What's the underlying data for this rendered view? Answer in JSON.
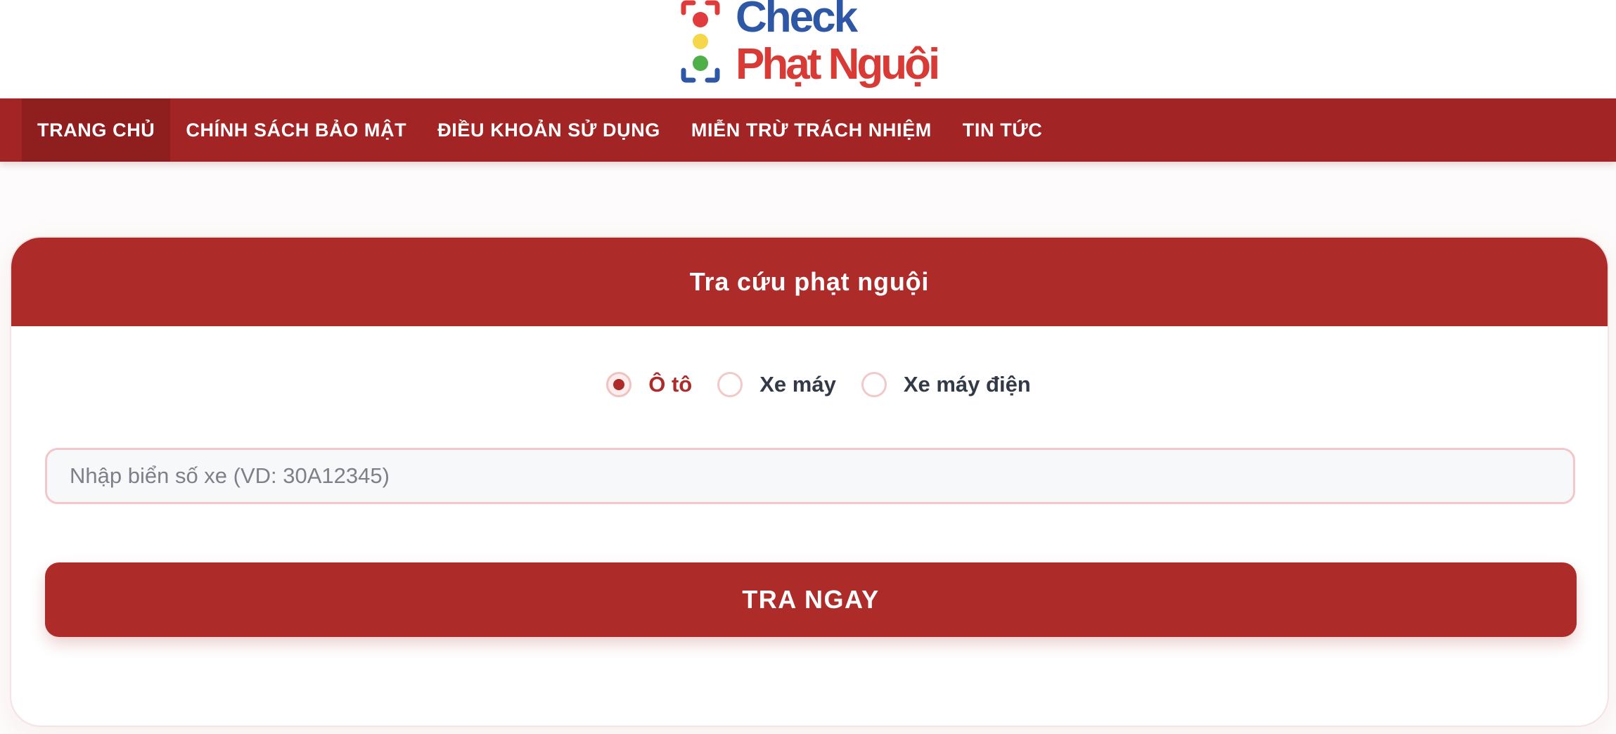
{
  "header": {
    "logo": {
      "line1": "Check",
      "line2": "Phạt Nguội",
      "colors": {
        "check": "#2e57a6",
        "phat_nguoi": "#d83a35",
        "light_red": "#e13b3b",
        "light_yellow": "#f6d64a",
        "light_green": "#4fb04a",
        "bracket_top": "#e03b3b",
        "bracket_bottom": "#2e57a6"
      }
    }
  },
  "nav": {
    "items": [
      {
        "label": "TRANG CHỦ",
        "active": true
      },
      {
        "label": "CHÍNH SÁCH BẢO MẬT",
        "active": false
      },
      {
        "label": "ĐIỀU KHOẢN SỬ DỤNG",
        "active": false
      },
      {
        "label": "MIỄN TRỪ TRÁCH NHIỆM",
        "active": false
      },
      {
        "label": "TIN TỨC",
        "active": false
      }
    ]
  },
  "search": {
    "title": "Tra cứu phạt nguội",
    "vehicle_types": [
      {
        "label": "Ô tô",
        "checked": true
      },
      {
        "label": "Xe máy",
        "checked": false
      },
      {
        "label": "Xe máy điện",
        "checked": false
      }
    ],
    "plate_input": {
      "value": "",
      "placeholder": "Nhập biển số xe (VD: 30A12345)"
    },
    "submit_label": "TRA NGAY"
  },
  "colors": {
    "primary": "#ad2b29",
    "nav_background": "#a32424",
    "nav_active": "#8f1f1f",
    "page_background": "#fdfbfb",
    "input_border": "#f3c7c9",
    "text_dark": "#333a47"
  }
}
